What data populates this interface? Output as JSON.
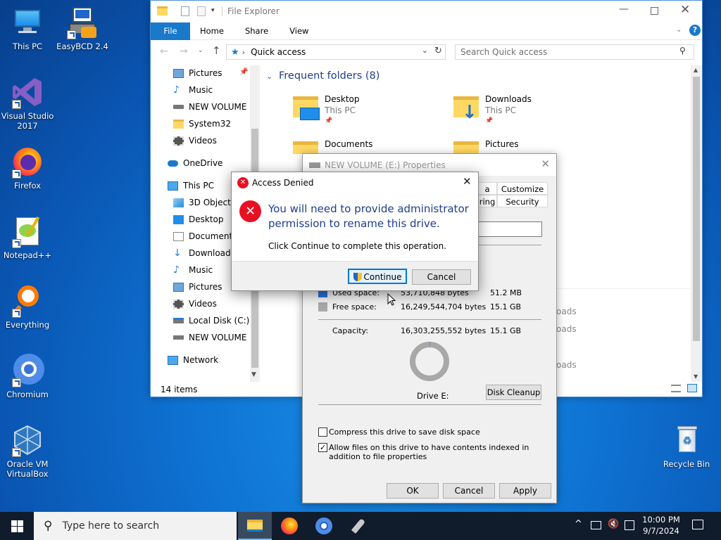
{
  "desktop": {
    "icons": [
      {
        "label": "This PC"
      },
      {
        "label": "EasyBCD 2.4"
      },
      {
        "label": "Visual Studio 2017"
      },
      {
        "label": "Firefox"
      },
      {
        "label": "Notepad++"
      },
      {
        "label": "Everything"
      },
      {
        "label": "Chromium"
      },
      {
        "label": "Oracle VM VirtualBox"
      },
      {
        "label": "Recycle Bin"
      }
    ]
  },
  "explorer": {
    "title": "File Explorer",
    "ribbon_tabs": [
      "File",
      "Home",
      "Share",
      "View"
    ],
    "address": "Quick access",
    "search_placeholder": "Search Quick access",
    "nav": [
      "Pictures",
      "Music",
      "NEW VOLUME (E:)",
      "System32",
      "Videos",
      "OneDrive",
      "This PC",
      "3D Objects",
      "Desktop",
      "Documents",
      "Downloads",
      "Music",
      "Pictures",
      "Videos",
      "Local Disk (C:)",
      "NEW VOLUME (E:)",
      "Network"
    ],
    "section_title": "Frequent folders (8)",
    "folders": [
      {
        "name": "Desktop",
        "sub": "This PC"
      },
      {
        "name": "Downloads",
        "sub": "This PC"
      },
      {
        "name": "Documents",
        "sub": "This PC"
      },
      {
        "name": "Pictures",
        "sub": "This PC"
      }
    ],
    "recent_fragments": [
      "oads",
      "oads",
      "oads"
    ],
    "status": "14 items"
  },
  "properties": {
    "title": "NEW VOLUME (E:) Properties",
    "tabs": [
      "a",
      "Customize",
      "ring",
      "Security"
    ],
    "used_label": "Used space:",
    "used_bytes": "53,710,848 bytes",
    "used_size": "51.2 MB",
    "free_label": "Free space:",
    "free_bytes": "16,249,544,704 bytes",
    "free_size": "15.1 GB",
    "capacity_label": "Capacity:",
    "capacity_bytes": "16,303,255,552 bytes",
    "capacity_size": "15.1 GB",
    "drive_label": "Drive E:",
    "disk_cleanup": "Disk Cleanup",
    "compress": "Compress this drive to save disk space",
    "index": "Allow files on this drive to have contents indexed in addition to file properties",
    "compress_checked": false,
    "index_checked": true,
    "used_fraction": 0.0033,
    "ok": "OK",
    "cancel": "Cancel",
    "apply": "Apply"
  },
  "denied": {
    "title": "Access Denied",
    "message": "You will need to provide administrator permission to rename this drive.",
    "hint": "Click Continue to complete this operation.",
    "continue": "Continue",
    "cancel": "Cancel"
  },
  "taskbar": {
    "search_placeholder": "Type here to search",
    "time": "10:00 PM",
    "date": "9/7/2024"
  },
  "colors": {
    "accent": "#1979ca",
    "link_blue": "#1e5aa8",
    "error_red": "#e81123"
  }
}
